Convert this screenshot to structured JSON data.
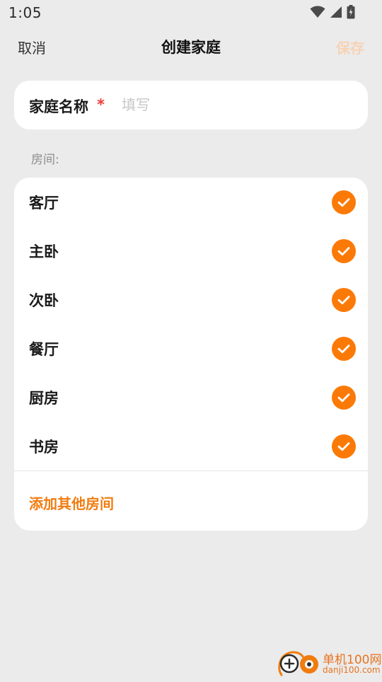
{
  "status_bar": {
    "time": "1:05",
    "icons": [
      "wifi-icon",
      "cellular-signal-icon",
      "battery-charging-icon"
    ]
  },
  "header": {
    "cancel_label": "取消",
    "title": "创建家庭",
    "save_label": "保存"
  },
  "family_name": {
    "label": "家庭名称",
    "required_mark": "*",
    "value": "",
    "placeholder": "填写"
  },
  "rooms": {
    "section_label": "房间:",
    "items": [
      {
        "label": "客厅",
        "checked": true
      },
      {
        "label": "主卧",
        "checked": true
      },
      {
        "label": "次卧",
        "checked": true
      },
      {
        "label": "餐厅",
        "checked": true
      },
      {
        "label": "厨房",
        "checked": true
      },
      {
        "label": "书房",
        "checked": true
      }
    ],
    "add_other_label": "添加其他房间"
  },
  "watermark": {
    "title": "单机100网",
    "url": "danji100.com"
  },
  "colors": {
    "accent": "#fb7a07",
    "add_link": "#f07c10",
    "save_disabled": "#f6d3b5",
    "required": "#ef3b3b",
    "background": "#ebebeb",
    "card": "#ffffff"
  }
}
